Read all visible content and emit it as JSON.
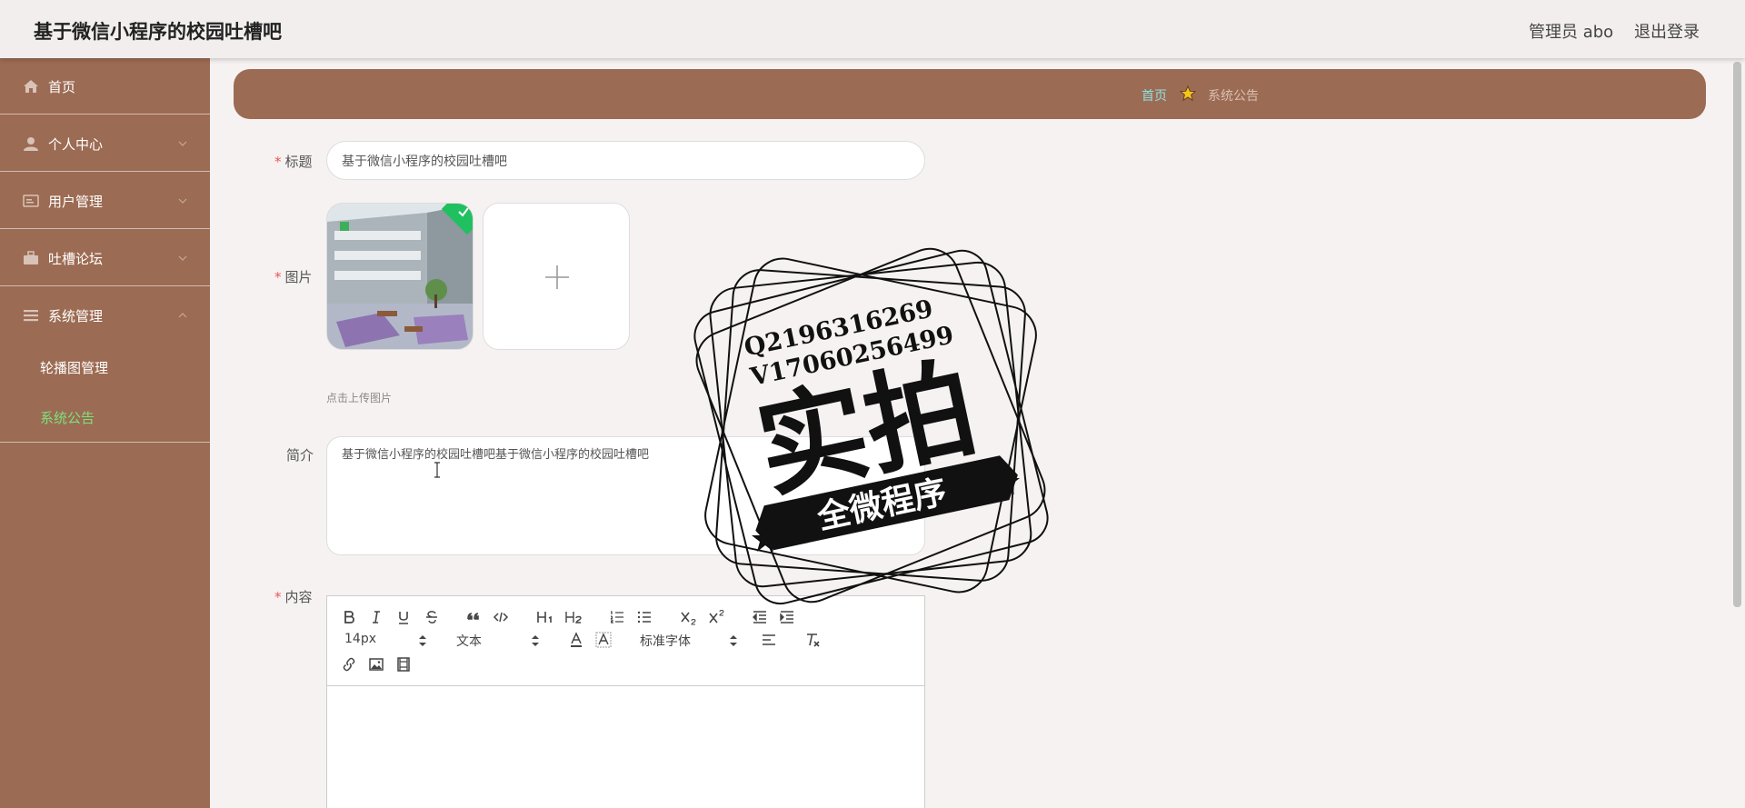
{
  "header": {
    "app_title": "基于微信小程序的校园吐槽吧",
    "user_label": "管理员 abo",
    "logout_label": "退出登录"
  },
  "sidebar": {
    "items": [
      {
        "label": "首页",
        "icon": "home-icon"
      },
      {
        "label": "个人中心",
        "icon": "user-icon"
      },
      {
        "label": "用户管理",
        "icon": "id-card-icon"
      },
      {
        "label": "吐槽论坛",
        "icon": "briefcase-icon"
      },
      {
        "label": "系统管理",
        "icon": "list-icon"
      }
    ],
    "sub_items": [
      {
        "label": "轮播图管理",
        "active": false
      },
      {
        "label": "系统公告",
        "active": true
      }
    ]
  },
  "breadcrumb": {
    "home": "首页",
    "current": "系统公告"
  },
  "form": {
    "title_label": "标题",
    "title_value": "基于微信小程序的校园吐槽吧",
    "image_label": "图片",
    "upload_tip": "点击上传图片",
    "brief_label": "简介",
    "brief_value": "基于微信小程序的校园吐槽吧基于微信小程序的校园吐槽吧",
    "content_label": "内容",
    "required_mark": "*"
  },
  "editor": {
    "size_select": "14px",
    "header_select": "文本",
    "font_select": "标准字体"
  },
  "watermark": {
    "line1": "Q2196316269",
    "line2": "V17060256499",
    "big_text": "实拍",
    "banner_text": "全微程序"
  },
  "colors": {
    "sidebar_bg": "#9c6b53",
    "active_sub": "#7de07d",
    "crumb_home": "#8ce1e1",
    "required": "#e55555"
  }
}
